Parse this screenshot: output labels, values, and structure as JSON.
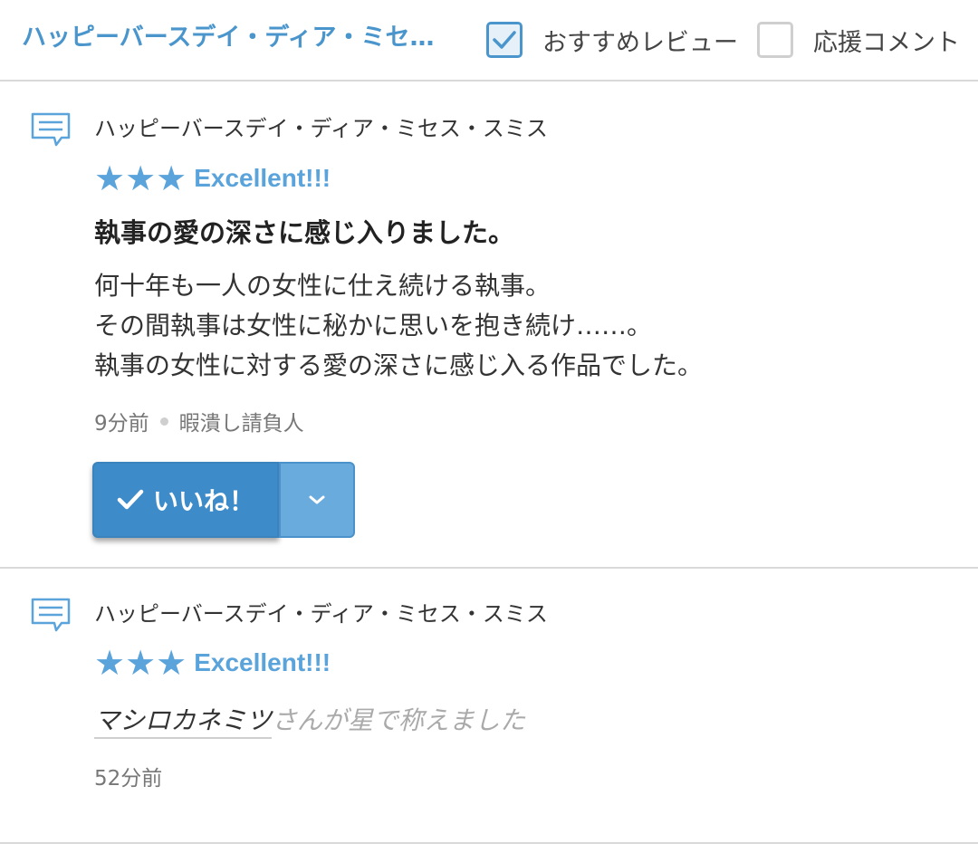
{
  "header": {
    "title": "ハッピーバースデイ・ディア・ミセス・スミス",
    "filters": [
      {
        "label": "おすすめレビュー",
        "checked": true
      },
      {
        "label": "応援コメント",
        "checked": false
      }
    ]
  },
  "reviews": [
    {
      "work_title": "ハッピーバースデイ・ディア・ミセス・スミス",
      "stars": "★★★",
      "rating_label": "Excellent!!!",
      "title": "執事の愛の深さに感じ入りました。",
      "body": [
        "何十年も一人の女性に仕え続ける執事。",
        "その間執事は女性に秘かに思いを抱き続け……。",
        "執事の女性に対する愛の深さに感じ入る作品でした。"
      ],
      "time": "9分前",
      "author": "暇潰し請負人",
      "like_label": "いいね！"
    },
    {
      "work_title": "ハッピーバースデイ・ディア・ミセス・スミス",
      "stars": "★★★",
      "rating_label": "Excellent!!!",
      "praise_user": "マシロカネミツ",
      "praise_text": "さんが星で称えました",
      "time": "52分前"
    }
  ]
}
